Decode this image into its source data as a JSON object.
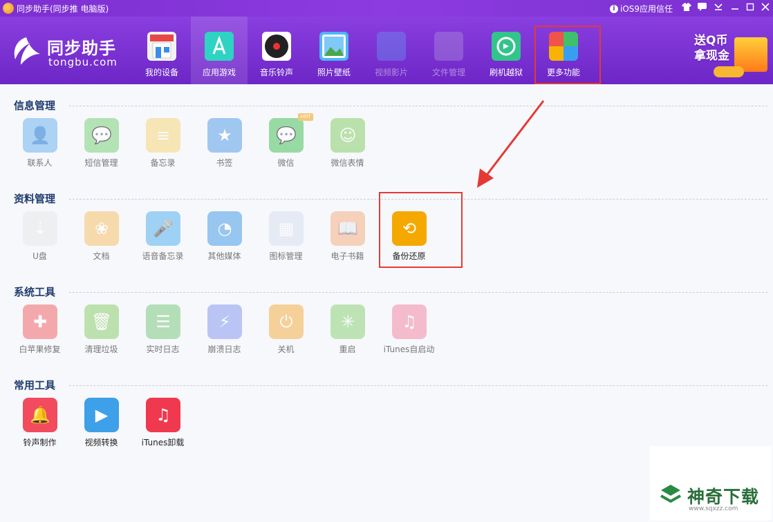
{
  "titlebar": {
    "title": "同步助手(同步推 电脑版)",
    "trust_label": "iOS9应用信任",
    "controls": [
      "shirt",
      "chat",
      "menu",
      "minimize",
      "maximize",
      "close"
    ]
  },
  "logo": {
    "cn": "同步助手",
    "en": "tongbu.com"
  },
  "nav": [
    {
      "label": "我的设备",
      "icon": "store-icon",
      "color": "#f2f2f2"
    },
    {
      "label": "应用游戏",
      "icon": "appstore-icon",
      "color": "#2ed3c3",
      "active": true
    },
    {
      "label": "音乐铃声",
      "icon": "music-disc-icon",
      "color": "#ffffff"
    },
    {
      "label": "照片壁纸",
      "icon": "photo-icon",
      "color": "#4db6f5"
    },
    {
      "label": "视频影片",
      "icon": "film-icon",
      "color": "#6a8df0",
      "dim": true
    },
    {
      "label": "文件管理",
      "icon": "file-icon",
      "color": "#a98ad8",
      "dim": true
    },
    {
      "label": "刷机越狱",
      "icon": "refresh-icon",
      "color": "#33c48c"
    },
    {
      "label": "更多功能",
      "icon": "grid-icon",
      "color": "#ffb400"
    }
  ],
  "promo": {
    "line1": "送Q币",
    "line2": "拿现金"
  },
  "sections": [
    {
      "title": "信息管理",
      "items": [
        {
          "label": "联系人",
          "icon": "contacts-icon",
          "color": "#6fb4ef",
          "glyph": "👤"
        },
        {
          "label": "短信管理",
          "icon": "sms-icon",
          "color": "#7dd17a",
          "glyph": "💬"
        },
        {
          "label": "备忘录",
          "icon": "memo-icon",
          "color": "#f6d67c",
          "glyph": "≡"
        },
        {
          "label": "书签",
          "icon": "bookmark-icon",
          "color": "#5aa0e8",
          "glyph": "★"
        },
        {
          "label": "微信",
          "icon": "wechat-icon",
          "color": "#4cc25c",
          "glyph": "💬",
          "badge": "HOT"
        },
        {
          "label": "微信表情",
          "icon": "emoji-icon",
          "color": "#8ad06a",
          "glyph": "☺"
        }
      ]
    },
    {
      "title": "资料管理",
      "items": [
        {
          "label": "U盘",
          "icon": "usb-drive-icon",
          "color": "#e8e8e8",
          "glyph": "⇣"
        },
        {
          "label": "文档",
          "icon": "document-icon",
          "color": "#f6c36a",
          "glyph": "❀"
        },
        {
          "label": "语音备忘录",
          "icon": "microphone-icon",
          "color": "#56b3ef",
          "glyph": "🎤"
        },
        {
          "label": "其他媒体",
          "icon": "media-icon",
          "color": "#4a9ee8",
          "glyph": "◔"
        },
        {
          "label": "图标管理",
          "icon": "icon-grid-icon",
          "color": "#d8e0f0",
          "glyph": "▦"
        },
        {
          "label": "电子书籍",
          "icon": "ebook-icon",
          "color": "#f5b287",
          "glyph": "📖"
        },
        {
          "label": "备份还原",
          "icon": "backup-restore-icon",
          "color": "#f5a800",
          "glyph": "⟲",
          "strong": true
        }
      ]
    },
    {
      "title": "系统工具",
      "items": [
        {
          "label": "白苹果修复",
          "icon": "apple-fix-icon",
          "color": "#f06a6a",
          "glyph": "✚"
        },
        {
          "label": "清理垃圾",
          "icon": "trash-icon",
          "color": "#8fcf6f",
          "glyph": "🗑"
        },
        {
          "label": "实时日志",
          "icon": "log-icon",
          "color": "#7fc97f",
          "glyph": "☰"
        },
        {
          "label": "崩溃日志",
          "icon": "crash-log-icon",
          "color": "#8a9df0",
          "glyph": "⚡"
        },
        {
          "label": "关机",
          "icon": "power-icon",
          "color": "#f5b04a",
          "glyph": "⏻"
        },
        {
          "label": "重启",
          "icon": "restart-icon",
          "color": "#8fd27a",
          "glyph": "✳"
        },
        {
          "label": "iTunes自启动",
          "icon": "itunes-autostart-icon",
          "color": "#f28aa8",
          "glyph": "♫"
        }
      ]
    },
    {
      "title": "常用工具",
      "items": [
        {
          "label": "铃声制作",
          "icon": "ringtone-icon",
          "color": "#f24b5e",
          "glyph": "🔔",
          "strong": true
        },
        {
          "label": "视频转换",
          "icon": "video-convert-icon",
          "color": "#3ea0e8",
          "glyph": "▶",
          "strong": true
        },
        {
          "label": "iTunes卸载",
          "icon": "itunes-uninstall-icon",
          "color": "#f0384e",
          "glyph": "♫",
          "strong": true
        }
      ]
    }
  ],
  "watermark": {
    "text": "神奇下载",
    "url": "www.sqxzz.com"
  }
}
